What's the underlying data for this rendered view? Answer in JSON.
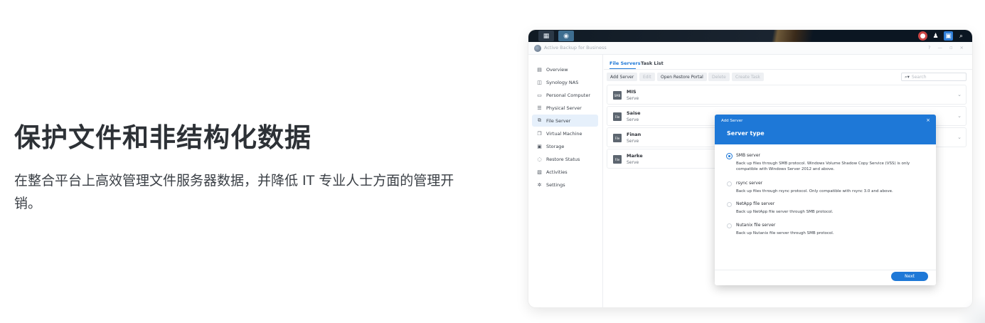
{
  "hero": {
    "title": "保护文件和非结构化数据",
    "description": "在整合平台上高效管理文件服务器数据，并降低 IT 专业人士方面的管理开销。"
  },
  "app": {
    "title": "Active Backup for Business",
    "window_controls": "? — ▫ ×"
  },
  "taskbar": {
    "main_menu_icon": "grid-icon",
    "app_icon": "active-backup-icon",
    "tray_icons": [
      "notification-icon",
      "user-icon",
      "widgets-icon",
      "search-icon"
    ]
  },
  "sidebar": {
    "items": [
      {
        "label": "Overview",
        "icon": "overview-icon",
        "glyph": "▤"
      },
      {
        "label": "Synology NAS",
        "icon": "nas-icon",
        "glyph": "◫"
      },
      {
        "label": "Personal Computer",
        "icon": "computer-icon",
        "glyph": "▭"
      },
      {
        "label": "Physical Server",
        "icon": "server-icon",
        "glyph": "☰"
      },
      {
        "label": "File Server",
        "icon": "file-server-icon",
        "glyph": "⧉"
      },
      {
        "label": "Virtual Machine",
        "icon": "vm-icon",
        "glyph": "❐"
      },
      {
        "label": "Storage",
        "icon": "storage-icon",
        "glyph": "▣"
      },
      {
        "label": "Restore Status",
        "icon": "restore-icon",
        "glyph": "◌"
      },
      {
        "label": "Activities",
        "icon": "activities-icon",
        "glyph": "▧"
      },
      {
        "label": "Settings",
        "icon": "gear-icon",
        "glyph": "✲"
      }
    ],
    "active_index": 4
  },
  "tabs": [
    "File Servers",
    "Task List"
  ],
  "toolbar": {
    "add_server": "Add Server",
    "edit": "Edit",
    "open_restore_portal": "Open Restore Portal",
    "delete": "Delete",
    "create_task": "Create Task",
    "search_placeholder": "Search"
  },
  "servers": [
    {
      "name": "MIS",
      "sub": "Serve",
      "badge": "SMB"
    },
    {
      "name": "Saise",
      "sub": "Serve",
      "badge": "File"
    },
    {
      "name": "Finan",
      "sub": "Serve",
      "badge": "File"
    },
    {
      "name": "Marke",
      "sub": "Serve",
      "badge": "File"
    }
  ],
  "modal": {
    "header": "Add Server",
    "title": "Server type",
    "options": [
      {
        "label": "SMB server",
        "desc": "Back up files through SMB protocol. Windows Volume Shadow Copy Service (VSS) is only compatible with Windows Server 2012 and above.",
        "selected": true
      },
      {
        "label": "rsync server",
        "desc": "Back up files through rsync protocol. Only compatible with rsync 3.0 and above.",
        "selected": false
      },
      {
        "label": "NetApp file server",
        "desc": "Back up NetApp file server through SMB protocol.",
        "selected": false
      },
      {
        "label": "Nutanix file server",
        "desc": "Back up Nutanix file server through SMB protocol.",
        "selected": false
      }
    ],
    "next": "Next"
  },
  "colors": {
    "accent": "#1e78d7",
    "active_nav_bg": "#e6f0fb"
  }
}
